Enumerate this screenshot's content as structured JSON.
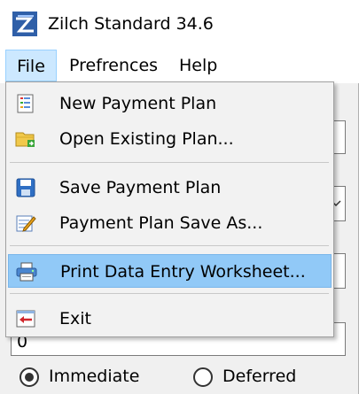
{
  "window": {
    "title": "Zilch Standard 34.6",
    "icon": "zilch-logo-icon"
  },
  "menubar": {
    "items": [
      {
        "label": "File",
        "active": true
      },
      {
        "label": "Prefrences"
      },
      {
        "label": "Help"
      }
    ]
  },
  "file_menu": {
    "items": [
      {
        "label": "New Payment Plan",
        "icon": "new-document-icon"
      },
      {
        "label": "Open Existing Plan...",
        "icon": "open-folder-icon"
      },
      {
        "label": "Save Payment Plan",
        "icon": "save-disk-icon"
      },
      {
        "label": "Payment Plan Save As...",
        "icon": "save-as-icon"
      },
      {
        "label": "Print Data Entry Worksheet...",
        "icon": "printer-icon",
        "highlighted": true
      },
      {
        "label": "Exit",
        "icon": "exit-icon"
      }
    ]
  },
  "background_form": {
    "field_value": "0",
    "radio_options": [
      {
        "label": "Immediate",
        "selected": true
      },
      {
        "label": "Deferred",
        "selected": false
      }
    ]
  },
  "colors": {
    "menu_highlight": "#91c9f7",
    "menubar_active": "#cce8ff"
  }
}
